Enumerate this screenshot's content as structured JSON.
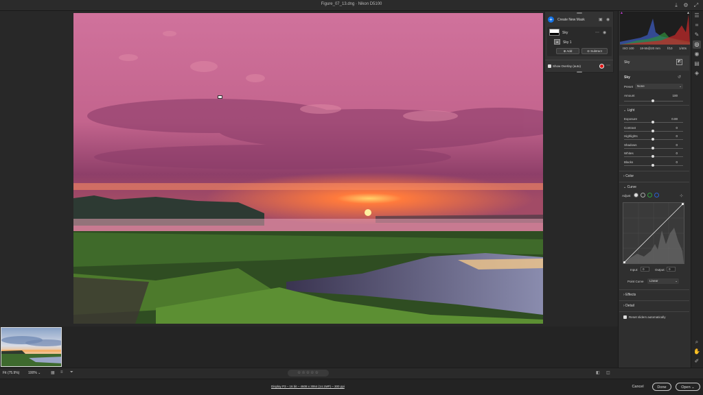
{
  "window": {
    "title": "Figure_07_13.dng",
    "camera": "Nikon D5100"
  },
  "mask_panel": {
    "create_label": "Create New Mask",
    "mask_name": "Sky",
    "component_name": "Sky 1",
    "add_label": "Add",
    "subtract_label": "Subtract",
    "overlay_label": "Show Overlay (auto)",
    "overlay_color": "#e01414"
  },
  "info": {
    "iso": "ISO 100",
    "lens": "18-55@20 mm",
    "aperture": "f/10",
    "shutter": "1/40s"
  },
  "right_panel": {
    "mask_header": "Sky",
    "mask_title": "Sky",
    "preset_label": "Preset",
    "preset_value": "None",
    "amount_label": "Amount",
    "amount_value": "100",
    "light_label": "Light",
    "sliders": [
      {
        "label": "Exposure",
        "value": "0.00"
      },
      {
        "label": "Contrast",
        "value": "0"
      },
      {
        "label": "Highlights",
        "value": "0"
      },
      {
        "label": "Shadows",
        "value": "0"
      },
      {
        "label": "Whites",
        "value": "0"
      },
      {
        "label": "Blacks",
        "value": "0"
      }
    ],
    "color_label": "Color",
    "curve_label": "Curve",
    "adjust_label": "Adjust",
    "input_label": "Input:",
    "input_value": "0",
    "output_label": "Output:",
    "output_value": "0",
    "point_curve_label": "Point Curve",
    "point_curve_value": "Linear",
    "effects_label": "Effects",
    "detail_label": "Detail",
    "reset_label": "Reset sliders automatically"
  },
  "bottom_bar": {
    "fit_label": "Fit (75.9%)",
    "zoom_label": "100%",
    "stars": "☆☆☆☆☆"
  },
  "footer": {
    "workflow": "Display P3 – 16 bit – 4608 x 3064 (14.1MP) – 300 ppi",
    "cancel": "Cancel",
    "done": "Done",
    "open": "Open"
  },
  "colors": {
    "accent": "#1473e6",
    "panel": "#2f2f2f",
    "background": "#1e1e1e"
  }
}
